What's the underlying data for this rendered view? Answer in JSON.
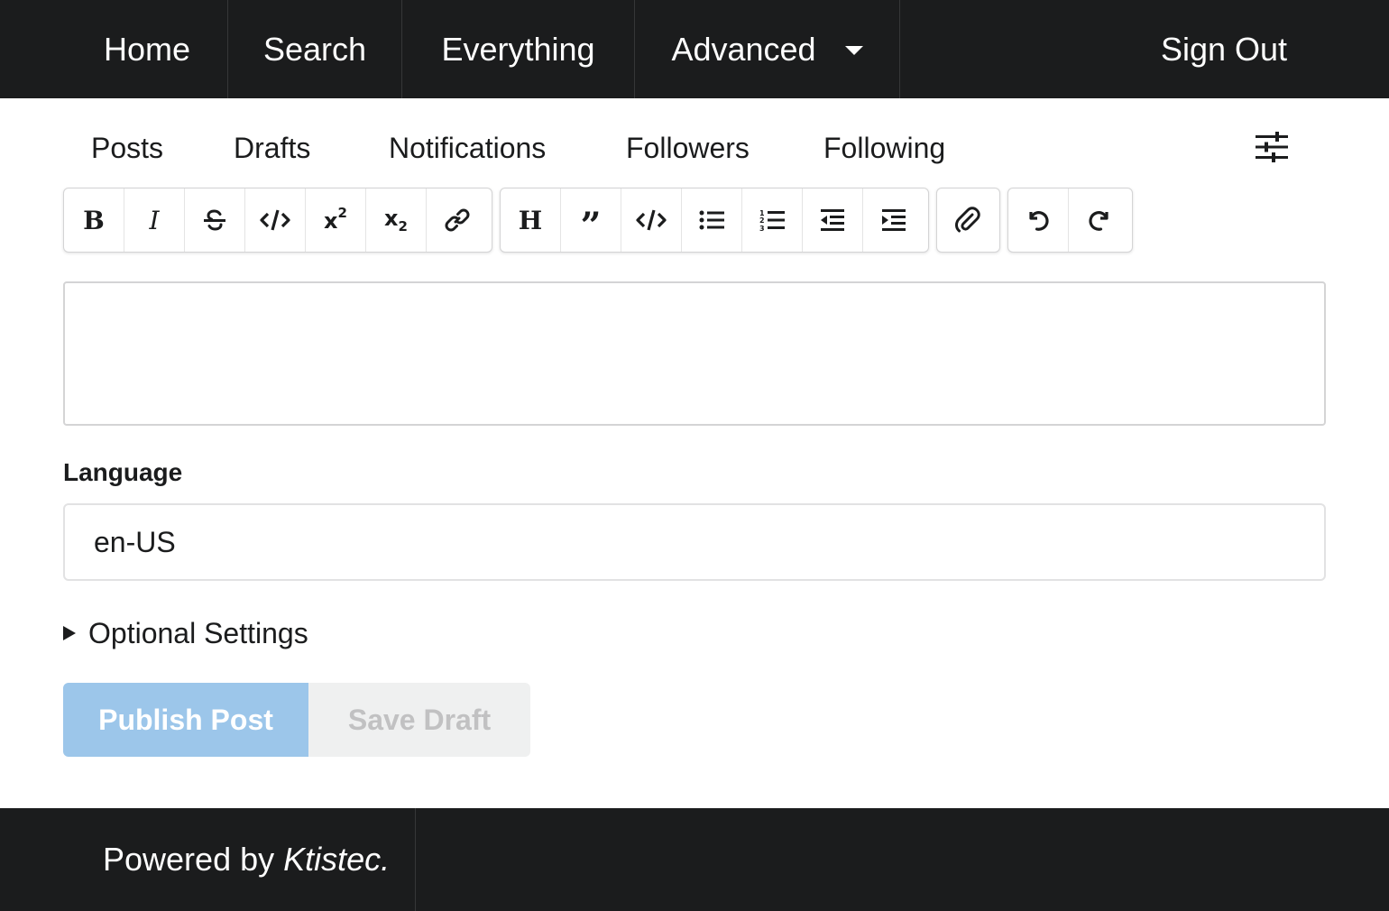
{
  "top_menu": {
    "home": "Home",
    "search": "Search",
    "everything": "Everything",
    "advanced": "Advanced",
    "sign_out": "Sign Out"
  },
  "sub_menu": {
    "posts": "Posts",
    "drafts": "Drafts",
    "notifications": "Notifications",
    "followers": "Followers",
    "following": "Following",
    "settings_icon": "sliders-icon"
  },
  "toolbar": {
    "groups": [
      [
        "bold-icon",
        "italic-icon",
        "strikethrough-icon",
        "code-icon",
        "superscript-icon",
        "subscript-icon",
        "link-icon"
      ],
      [
        "heading-icon",
        "quote-icon",
        "code-block-icon",
        "bullet-list-icon",
        "numbered-list-icon",
        "decrease-indent-icon",
        "increase-indent-icon"
      ],
      [
        "attach-icon"
      ],
      [
        "undo-icon",
        "redo-icon"
      ]
    ]
  },
  "editor": {
    "content": ""
  },
  "language": {
    "label": "Language",
    "value": "en-US"
  },
  "optional_settings": {
    "label": "Optional Settings"
  },
  "actions": {
    "publish": "Publish Post",
    "save_draft": "Save Draft"
  },
  "footer": {
    "powered_prefix": "Powered by",
    "powered_name": "Ktistec."
  },
  "colors": {
    "menu_bg": "#1b1c1d",
    "publish_bg": "#9cc6ea",
    "draft_bg": "#eff0f0",
    "draft_text": "#c1c1c2"
  }
}
